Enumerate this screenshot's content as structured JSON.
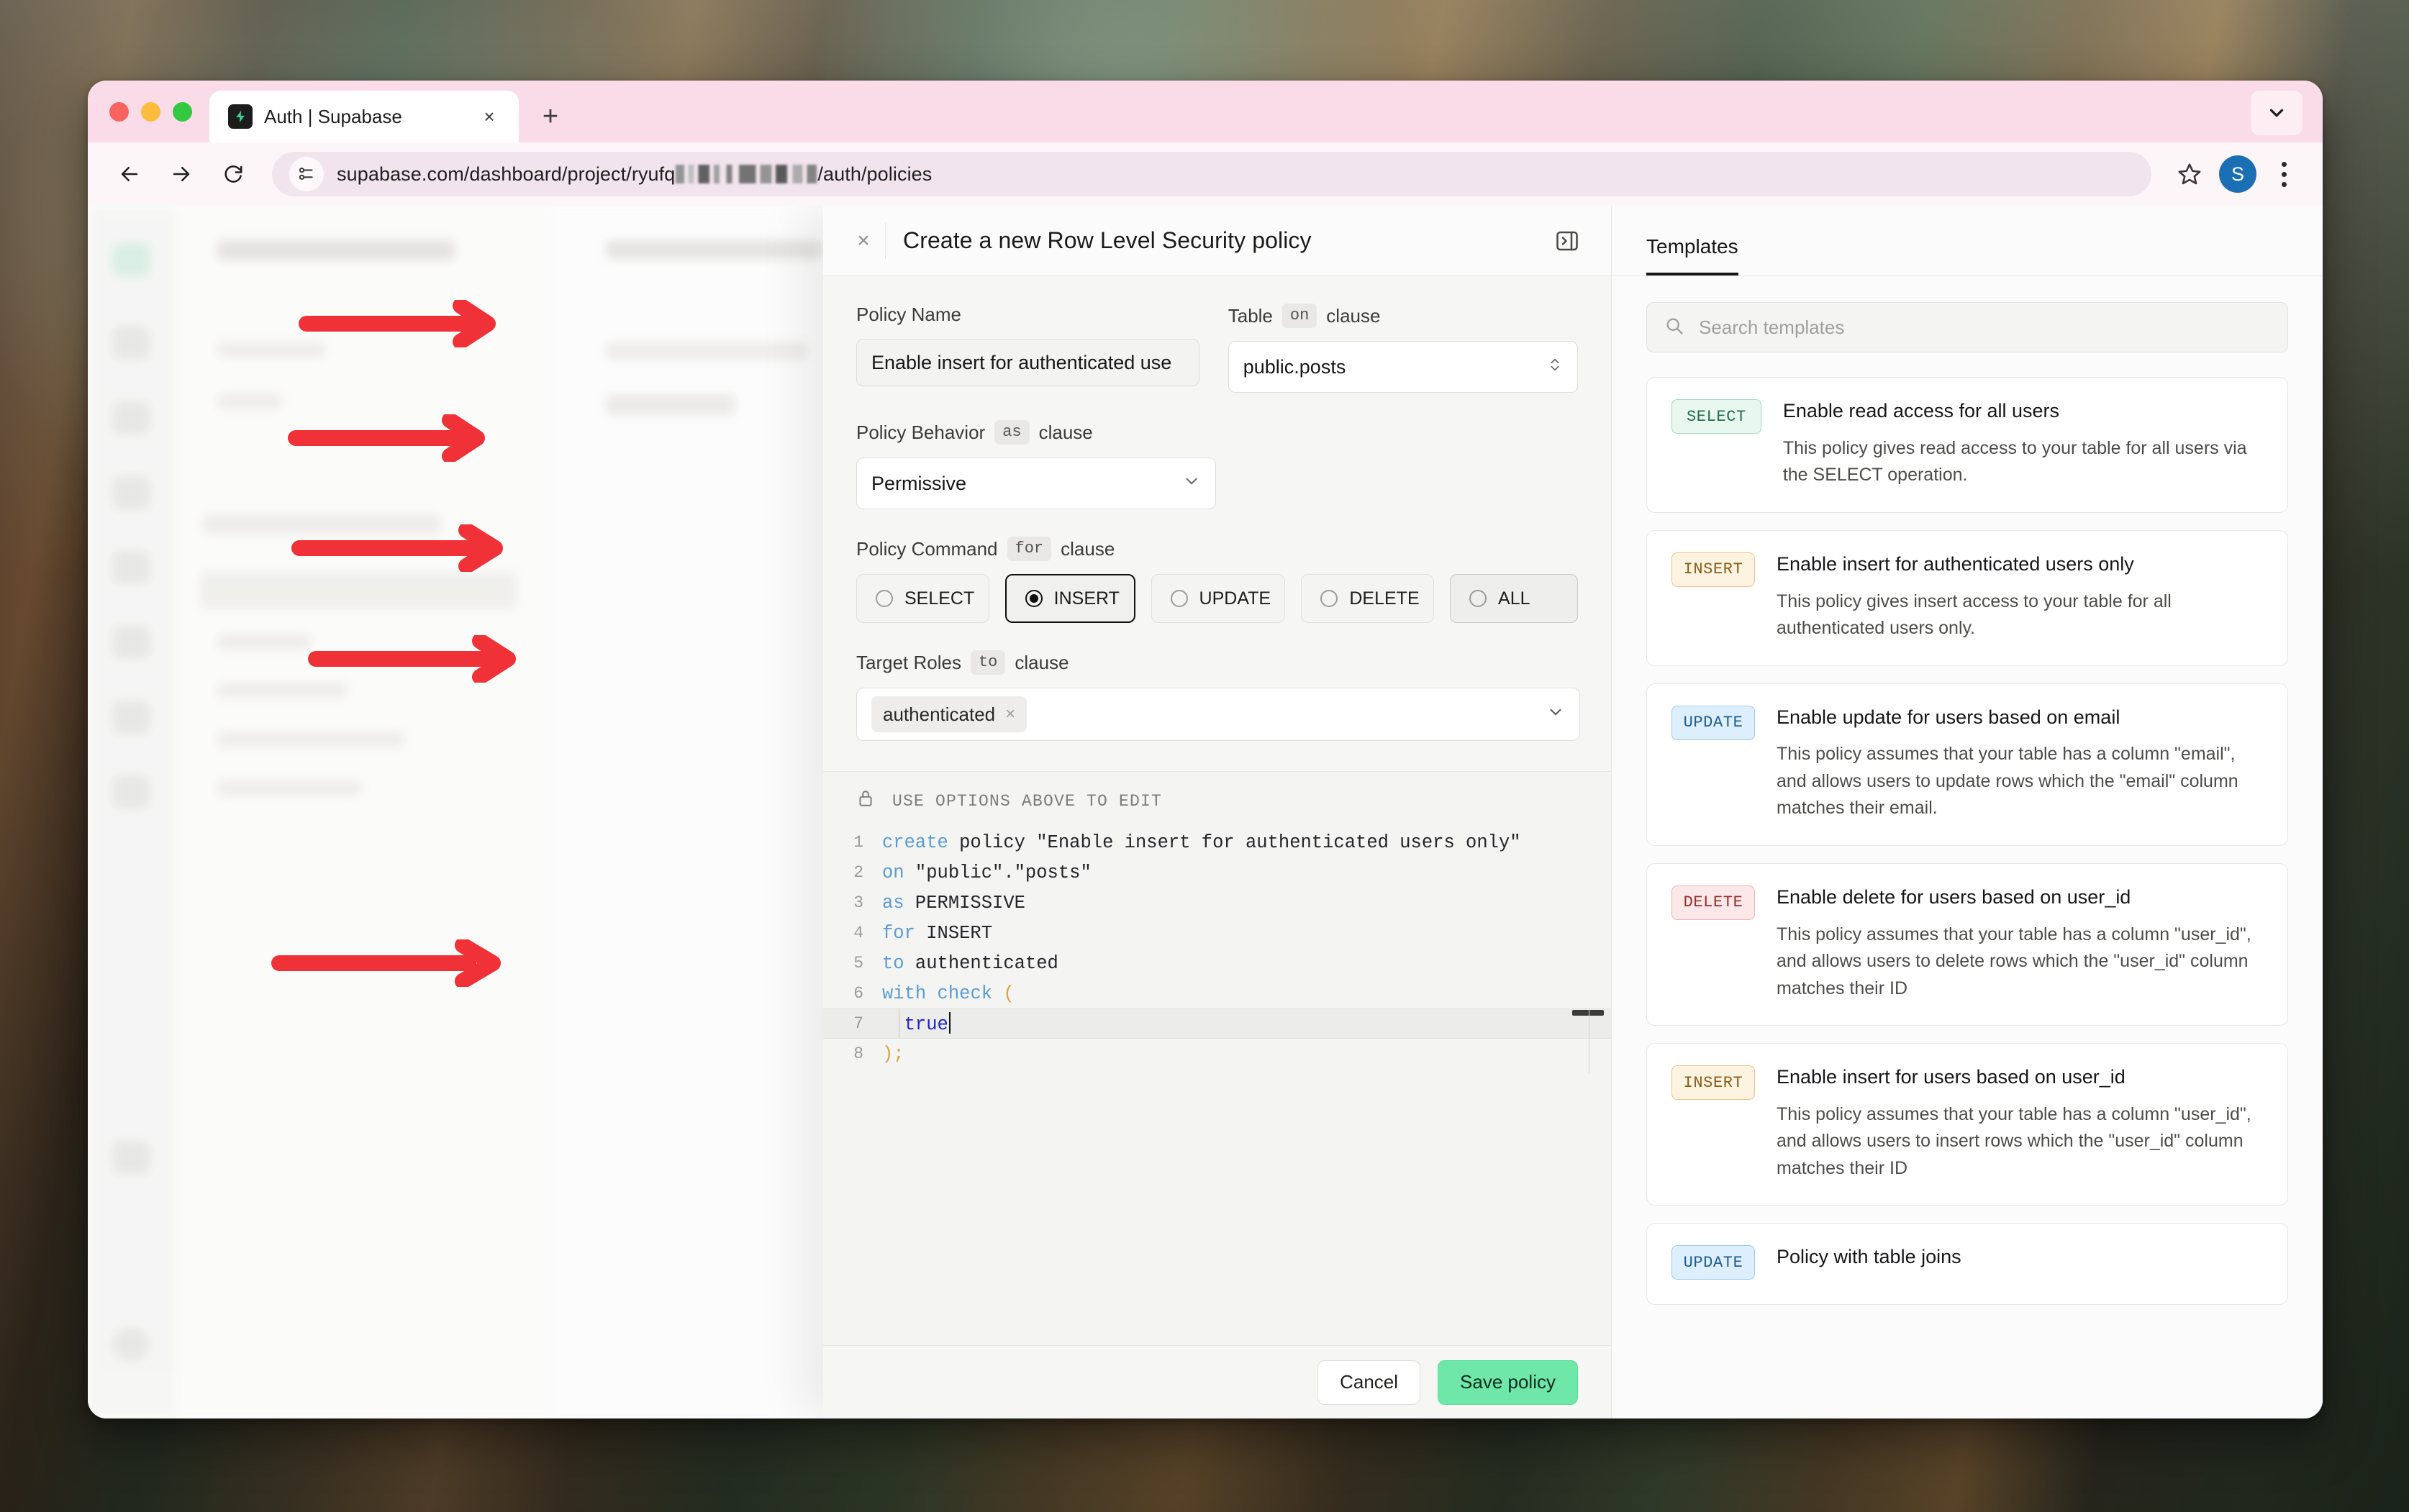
{
  "browser": {
    "tab_title": "Auth | Supabase",
    "tab_close": "×",
    "new_tab": "+",
    "url_prefix": "supabase.com/dashboard/project/ryufq",
    "url_suffix": "/auth/policies",
    "avatar_initial": "S"
  },
  "dialog": {
    "title": "Create a new Row Level Security policy",
    "close_label": "×",
    "fields": {
      "policy_name_label": "Policy Name",
      "policy_name_value": "Enable insert for authenticated use",
      "table_label": "Table",
      "table_keyword": "on",
      "clause_word": "clause",
      "table_value": "public.posts",
      "behavior_label": "Policy Behavior",
      "behavior_keyword": "as",
      "behavior_value": "Permissive",
      "command_label": "Policy Command",
      "command_keyword": "for",
      "roles_label": "Target Roles",
      "roles_keyword": "to",
      "role_chip": "authenticated",
      "role_chip_remove": "×"
    },
    "commands": [
      {
        "label": "SELECT",
        "selected": false,
        "variant": "normal"
      },
      {
        "label": "INSERT",
        "selected": true,
        "variant": "normal"
      },
      {
        "label": "UPDATE",
        "selected": false,
        "variant": "normal"
      },
      {
        "label": "DELETE",
        "selected": false,
        "variant": "normal"
      },
      {
        "label": "ALL",
        "selected": false,
        "variant": "alt"
      }
    ],
    "editor": {
      "banner": "USE OPTIONS ABOVE TO EDIT",
      "lines": [
        {
          "n": "1",
          "text": "create policy \"Enable insert for authenticated users only\""
        },
        {
          "n": "2",
          "text": "on \"public\".\"posts\""
        },
        {
          "n": "3",
          "text": "as PERMISSIVE"
        },
        {
          "n": "4",
          "text": "for INSERT"
        },
        {
          "n": "5",
          "text": "to authenticated"
        },
        {
          "n": "6",
          "text": "with check ("
        },
        {
          "n": "7",
          "text": "  true"
        },
        {
          "n": "8",
          "text": ");"
        }
      ]
    },
    "footer": {
      "cancel_label": "Cancel",
      "save_label": "Save policy"
    }
  },
  "templates": {
    "tab_label": "Templates",
    "search_placeholder": "Search templates",
    "cards": [
      {
        "badge": "SELECT",
        "badge_kind": "select",
        "title": "Enable read access for all users",
        "desc": "This policy gives read access to your table for all users via the SELECT operation."
      },
      {
        "badge": "INSERT",
        "badge_kind": "insert",
        "title": "Enable insert for authenticated users only",
        "desc": "This policy gives insert access to your table for all authenticated users only."
      },
      {
        "badge": "UPDATE",
        "badge_kind": "update",
        "title": "Enable update for users based on email",
        "desc": "This policy assumes that your table has a column \"email\", and allows users to update rows which the \"email\" column matches their email."
      },
      {
        "badge": "DELETE",
        "badge_kind": "delete",
        "title": "Enable delete for users based on user_id",
        "desc": "This policy assumes that your table has a column \"user_id\", and allows users to delete rows which the \"user_id\" column matches their ID"
      },
      {
        "badge": "INSERT",
        "badge_kind": "insert",
        "title": "Enable insert for users based on user_id",
        "desc": "This policy assumes that your table has a column \"user_id\", and allows users to insert rows which the \"user_id\" column matches their ID"
      },
      {
        "badge": "UPDATE",
        "badge_kind": "update",
        "title": "Policy with table joins",
        "desc": ""
      }
    ]
  },
  "annotations": {
    "arrow_color": "#f03137",
    "arrows": [
      {
        "name": "arrow-policy-name"
      },
      {
        "name": "arrow-policy-behavior"
      },
      {
        "name": "arrow-policy-command"
      },
      {
        "name": "arrow-target-roles"
      },
      {
        "name": "arrow-code-line-7"
      }
    ]
  }
}
